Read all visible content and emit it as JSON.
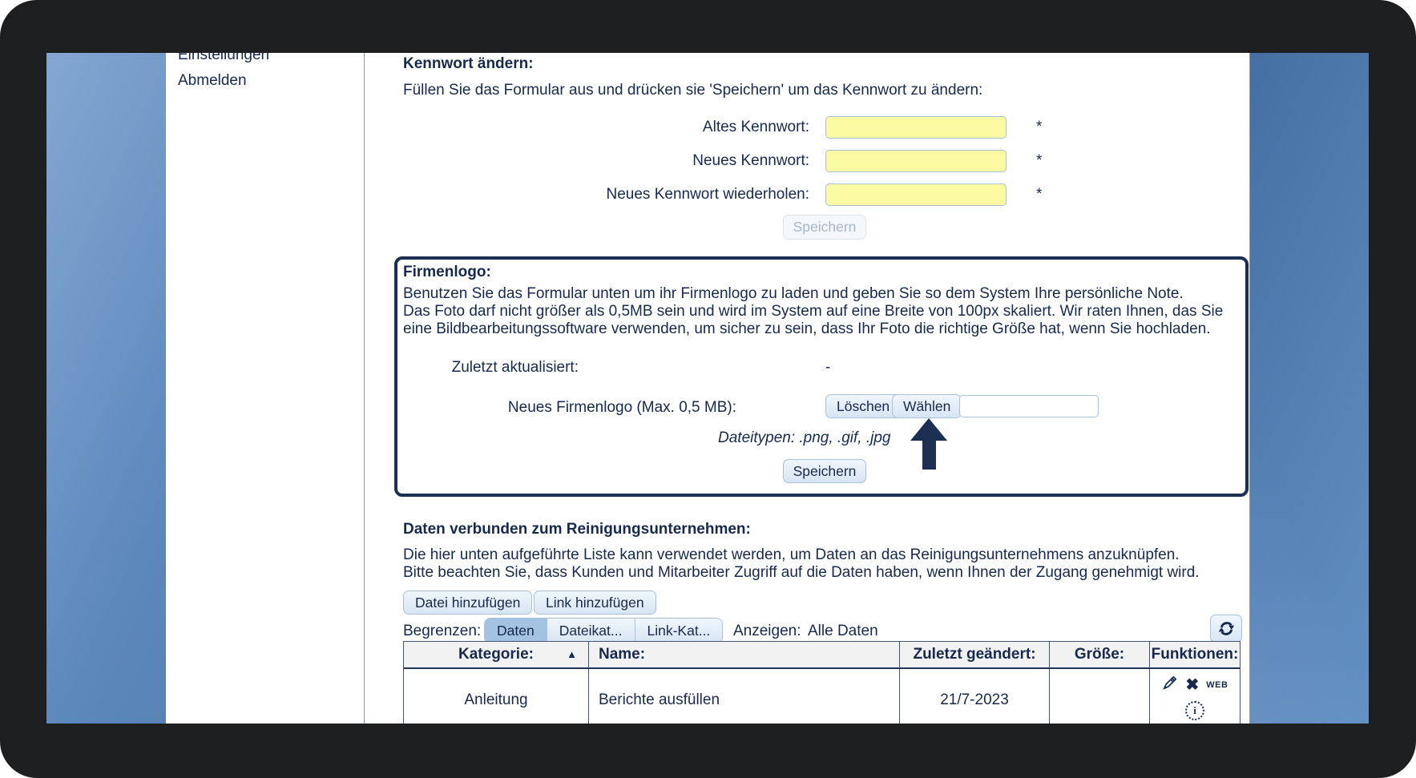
{
  "sidebar": {
    "items": [
      {
        "label": "Einstellungen"
      },
      {
        "label": "Abmelden"
      }
    ]
  },
  "password_section": {
    "title": "Kennwort ändern:",
    "instruction": "Füllen Sie das Formular aus und drücken sie 'Speichern' um das Kennwort zu ändern:",
    "fields": [
      {
        "label": "Altes Kennwort:",
        "value": "",
        "required_marker": "*"
      },
      {
        "label": "Neues Kennwort:",
        "value": "",
        "required_marker": "*"
      },
      {
        "label": "Neues Kennwort wiederholen:",
        "value": "",
        "required_marker": "*"
      }
    ],
    "save_label": "Speichern"
  },
  "logo_section": {
    "title": "Firmenlogo:",
    "description_line1": "Benutzen Sie das Formular unten um ihr Firmenlogo zu laden und geben Sie so dem System Ihre persönliche Note.",
    "description_line2": "Das Foto darf nicht größer als 0,5MB sein und wird im System auf eine Breite von 100px skaliert. Wir raten Ihnen, das Sie eine Bildbearbeitungssoftware verwenden, um sicher zu sein, dass Ihr Foto die richtige Größe hat, wenn Sie hochladen.",
    "last_updated_label": "Zuletzt aktualisiert:",
    "last_updated_value": "-",
    "new_logo_label": "Neues Firmenlogo (Max. 0,5 MB):",
    "delete_button": "Löschen",
    "choose_button": "Wählen",
    "file_input_value": "",
    "filetypes_note": "Dateitypen: .png, .gif, .jpg",
    "save_label": "Speichern"
  },
  "data_section": {
    "title": "Daten verbunden zum Reinigungsunternehmen:",
    "description": "Die hier unten aufgeführte Liste kann verwendet werden, um Daten an das Reinigungsunternehmens anzuknüpfen. Bitte beachten Sie, dass Kunden und Mitarbeiter Zugriff auf die Daten haben, wenn Ihnen der Zugang genehmigt wird.",
    "add_file_button": "Datei hinzufügen",
    "add_link_button": "Link hinzufügen",
    "limit_label": "Begrenzen:",
    "filter_tabs": [
      {
        "label": "Daten",
        "selected": true
      },
      {
        "label": "Dateikat...",
        "selected": false
      },
      {
        "label": "Link-Kat...",
        "selected": false
      }
    ],
    "show_label": "Anzeigen:",
    "show_value": "Alle Daten",
    "table": {
      "columns": [
        "Kategorie:",
        "Name:",
        "Zuletzt geändert:",
        "Größe:",
        "Funktionen:"
      ],
      "sort_column": "Kategorie:",
      "sort_glyph": "▲",
      "rows": [
        {
          "kategorie": "Anleitung",
          "name": "Berichte ausfüllen",
          "zuletzt_geaendert": "21/7-2023",
          "groesse": "",
          "web_label": "WEB",
          "x_glyph": "✖",
          "info_glyph": "i",
          "function_icons": [
            "pencil-icon",
            "delete-x-icon",
            "web-icon",
            "info-icon"
          ]
        }
      ]
    }
  },
  "icons": {
    "refresh": "refresh-icon",
    "sort_asc": "▲",
    "annotation_arrow": "up-arrow-icon"
  },
  "colors": {
    "navy_text": "#17294d",
    "box_border": "#1c2f52",
    "field_yellow": "#fafaa2",
    "button_border": "#a9c0da",
    "button_face": "#d7e5f4",
    "selected_tab": "#a4c2e2",
    "background_blue": "#4a77b4",
    "bezel_black": "#1d1e20"
  }
}
